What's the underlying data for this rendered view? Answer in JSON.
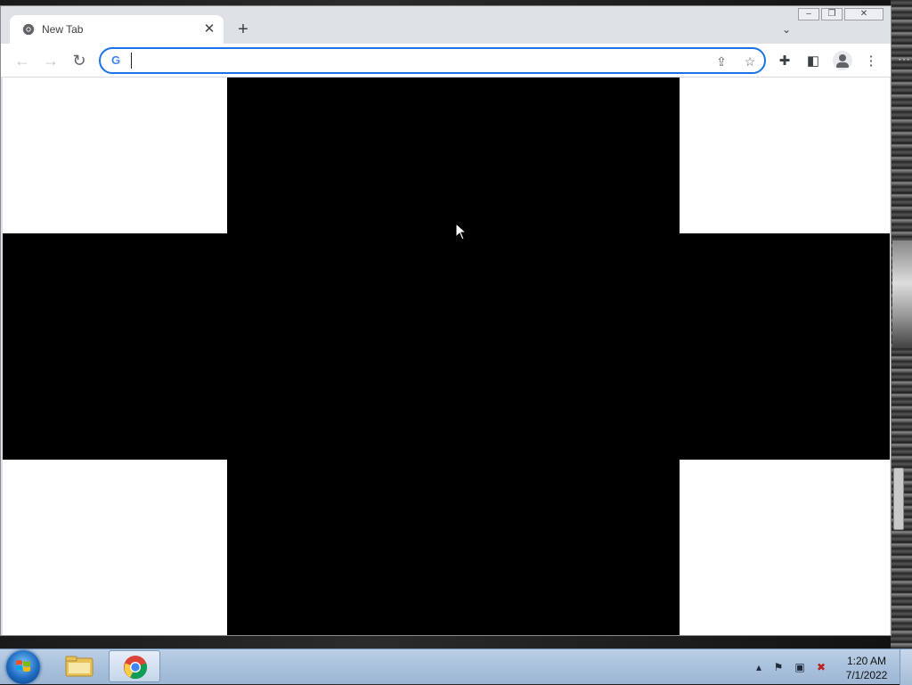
{
  "browser": {
    "tab": {
      "title": "New Tab"
    },
    "omnibox": {
      "value": "",
      "placeholder": ""
    }
  },
  "taskbar": {
    "clock": {
      "time": "1:20 AM",
      "date": "7/1/2022"
    }
  },
  "icons": {
    "tab_favicon": "chrome-icon",
    "tab_close": "close-icon",
    "new_tab": "plus-icon",
    "tab_search": "chevron-down-icon",
    "back": "arrow-left-icon",
    "forward": "arrow-right-icon",
    "reload": "reload-icon",
    "search_engine": "google-g-icon",
    "share": "share-icon",
    "bookmark": "star-icon",
    "extensions": "puzzle-icon",
    "side_panel": "side-panel-icon",
    "profile": "avatar-icon",
    "menu": "kebab-menu-icon"
  },
  "colors": {
    "accent": "#1a73e8",
    "tabstrip": "#dee1e6",
    "page_background": "#ffffff",
    "cross": "#000000",
    "taskbar": "#a9c1dc"
  }
}
